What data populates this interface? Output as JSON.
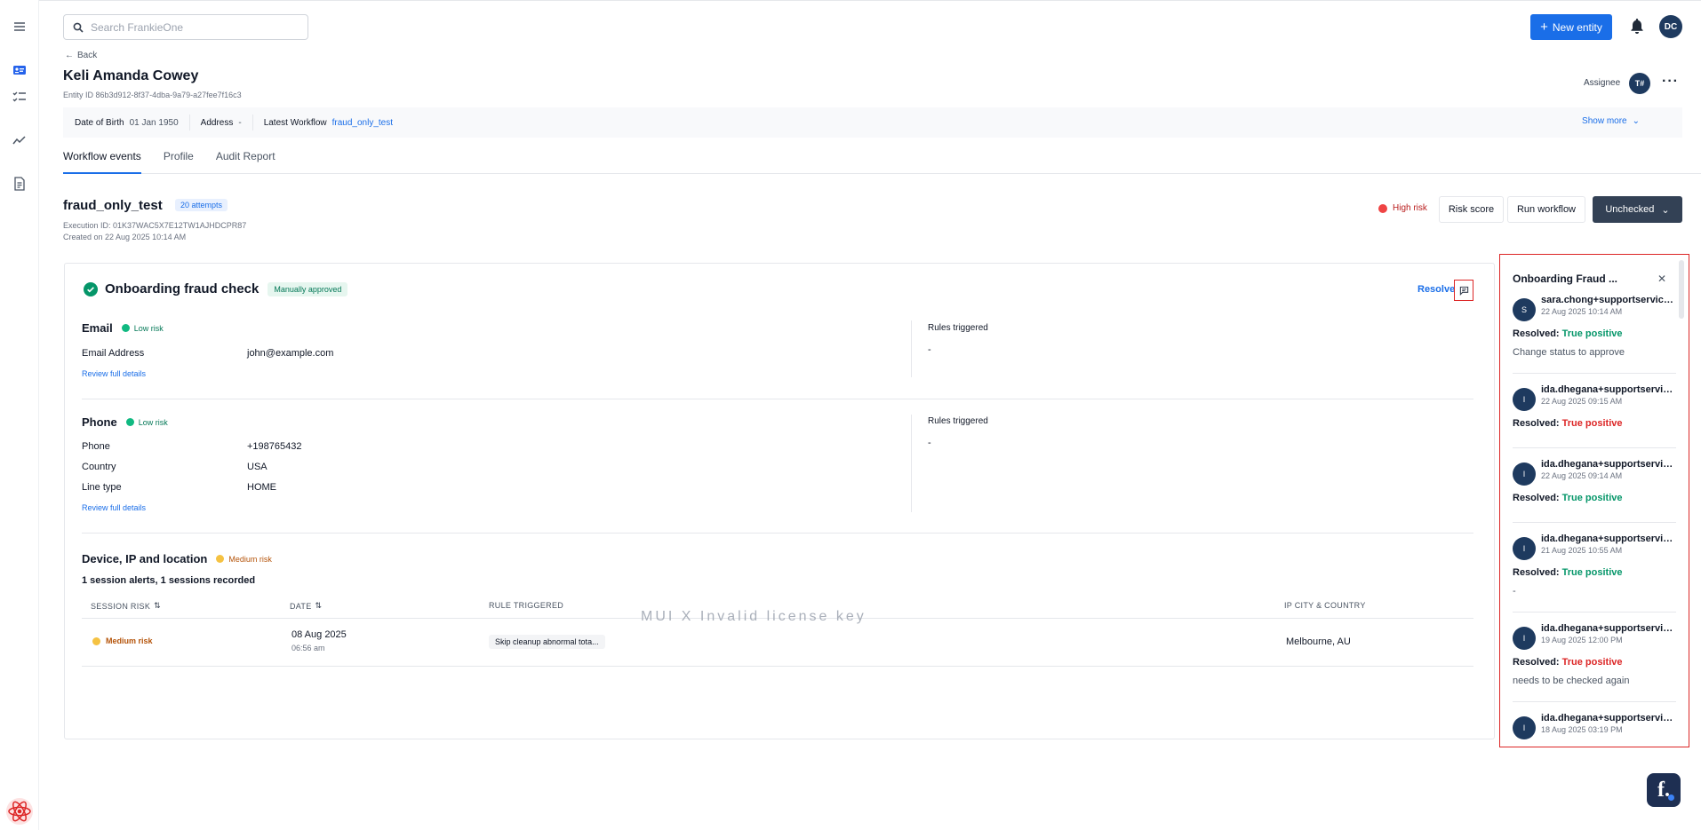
{
  "header": {
    "search_placeholder": "Search FrankieOne",
    "new_entity_label": "New entity",
    "user_initials": "DC"
  },
  "entity": {
    "back_label": "Back",
    "name": "Keli Amanda Cowey",
    "id_text": "Entity ID 86b3d912-8f37-4dba-9a79-a27fee7f16c3",
    "assignee_label": "Assignee",
    "assignee_initials": "T#"
  },
  "infobar": {
    "dob_label": "Date of Birth",
    "dob_value": "01 Jan 1950",
    "address_label": "Address",
    "address_value": "-",
    "workflow_label": "Latest Workflow",
    "workflow_value": "fraud_only_test",
    "show_more": "Show more"
  },
  "tabs": [
    "Workflow events",
    "Profile",
    "Audit Report"
  ],
  "workflow": {
    "name": "fraud_only_test",
    "attempts": "20 attempts",
    "execution_id": "Execution ID: 01K37WAC5X7E12TW1AJHDCPR87",
    "created_on": "Created on 22 Aug 2025 10:14 AM",
    "risk_label": "High risk",
    "risk_score_label": "Risk score",
    "run_workflow_label": "Run workflow",
    "status_label": "Unchecked"
  },
  "card": {
    "title": "Onboarding fraud check",
    "status_badge": "Manually approved",
    "resolve_label": "Resolve",
    "email": {
      "title": "Email",
      "risk": "Low risk",
      "address_label": "Email Address",
      "address_value": "john@example.com",
      "review": "Review full details",
      "rules_label": "Rules triggered",
      "rules_value": "-"
    },
    "phone": {
      "title": "Phone",
      "risk": "Low risk",
      "phone_label": "Phone",
      "phone_value": "+198765432",
      "country_label": "Country",
      "country_value": "USA",
      "line_label": "Line type",
      "line_value": "HOME",
      "review": "Review full details",
      "rules_label": "Rules triggered",
      "rules_value": "-"
    },
    "device": {
      "title": "Device, IP and location",
      "risk": "Medium risk",
      "summary": "1 session alerts, 1 sessions recorded",
      "columns": [
        "SESSION RISK",
        "DATE",
        "RULE TRIGGERED",
        "IP CITY & COUNTRY"
      ],
      "row": {
        "session_risk": "Medium risk",
        "date": "08 Aug 2025",
        "time": "06:56 am",
        "rule": "Skip cleanup abnormal tota...",
        "ip": "Melbourne, AU"
      },
      "watermark": "MUI X Invalid license key"
    }
  },
  "panel": {
    "title": "Onboarding Fraud ...",
    "notes": [
      {
        "initial": "S",
        "user": "sara.chong+supportservice@...",
        "time": "22 Aug 2025 10:14 AM",
        "resolved_label": "Resolved:",
        "resolution": "True positive",
        "resolution_color": "green",
        "comment": "Change status to approve"
      },
      {
        "initial": "I",
        "user": "ida.dhegana+supportservice...",
        "time": "22 Aug 2025 09:15 AM",
        "resolved_label": "Resolved:",
        "resolution": "True positive",
        "resolution_color": "red",
        "comment": ""
      },
      {
        "initial": "I",
        "user": "ida.dhegana+supportservice...",
        "time": "22 Aug 2025 09:14 AM",
        "resolved_label": "Resolved:",
        "resolution": "True positive",
        "resolution_color": "green",
        "comment": ""
      },
      {
        "initial": "I",
        "user": "ida.dhegana+supportservice...",
        "time": "21 Aug 2025 10:55 AM",
        "resolved_label": "Resolved:",
        "resolution": "True positive",
        "resolution_color": "green",
        "comment": "-"
      },
      {
        "initial": "I",
        "user": "ida.dhegana+supportservice...",
        "time": "19 Aug 2025 12:00 PM",
        "resolved_label": "Resolved:",
        "resolution": "True positive",
        "resolution_color": "red",
        "comment": "needs to be checked again"
      },
      {
        "initial": "I",
        "user": "ida.dhegana+supportservice...",
        "time": "18 Aug 2025 03:19 PM",
        "resolved_label": "",
        "resolution": "",
        "resolution_color": "green",
        "comment": ""
      }
    ]
  },
  "fab_label": "f."
}
